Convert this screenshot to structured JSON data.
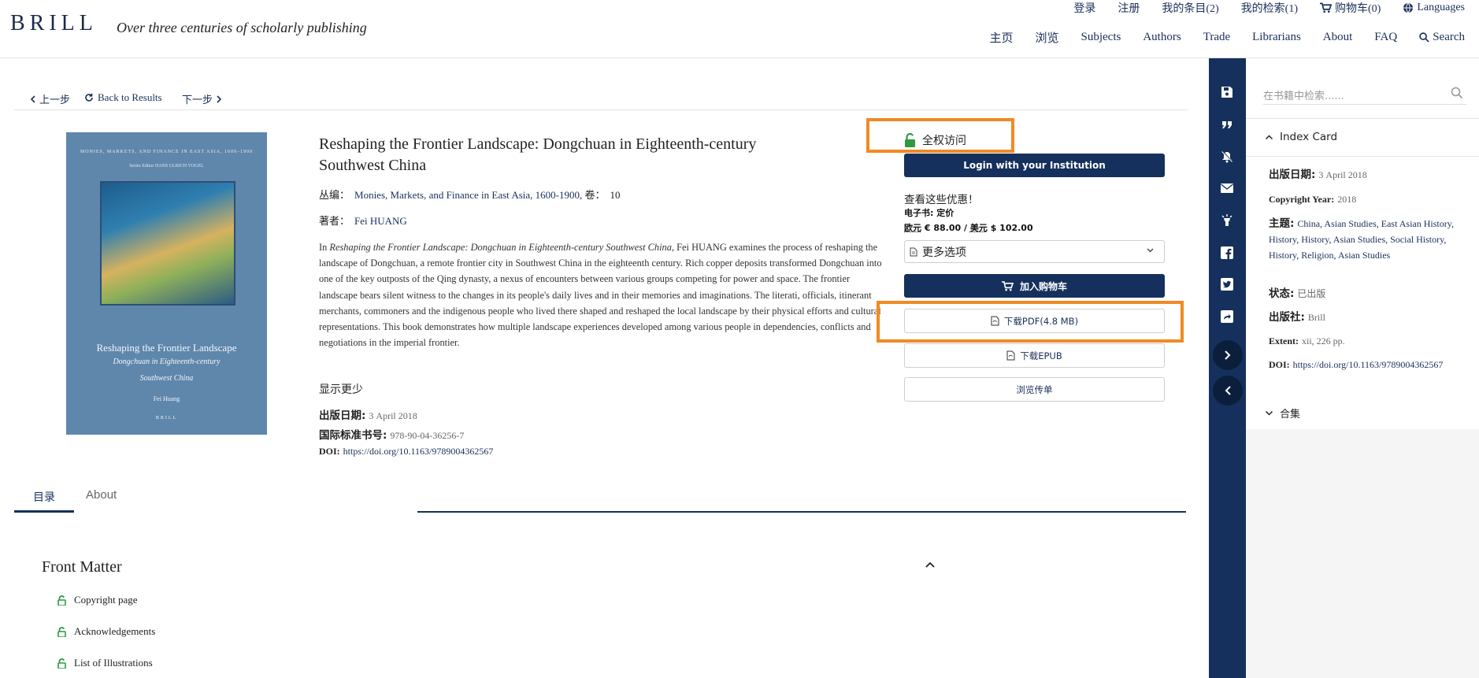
{
  "header": {
    "logo": "BRILL",
    "tagline": "Over three centuries of scholarly publishing",
    "utility_nav": [
      "登录",
      "注册",
      "我的条目(2)",
      "我的检索(1)",
      "购物车(0)",
      "Languages"
    ],
    "main_nav": [
      "主页",
      "浏览",
      "Subjects",
      "Authors",
      "Trade",
      "Librarians",
      "About",
      "FAQ",
      "Search"
    ]
  },
  "navigation": {
    "prev": "上一步",
    "back": "Back to Results",
    "next": "下一步"
  },
  "cover": {
    "series": "MONIES, MARKETS, AND FINANCE IN EAST ASIA, 1600–1900",
    "editor": "Series Editor HANS ULRICH VOGEL",
    "title": "Reshaping the Frontier Landscape",
    "subtitle_1": "Dongchuan in Eighteenth-century",
    "subtitle_2": "Southwest China",
    "author": "Fei Huang",
    "publisher": "BRILL"
  },
  "book": {
    "title": "Reshaping the Frontier Landscape: Dongchuan in Eighteenth-century Southwest China",
    "series_label": "丛编：",
    "series_value": "Monies, Markets, and Finance in East Asia, 1600-1900",
    "volume_label": "卷：",
    "volume_value": "10",
    "author_label": "著者：",
    "author_value": "Fei HUANG",
    "description_intro": "In ",
    "description_italic": "Reshaping the Frontier Landscape: Dongchuan in Eighteenth-century Southwest China",
    "description_rest": ", Fei HUANG examines the process of reshaping the landscape of Dongchuan, a remote frontier city in Southwest China in the eighteenth century. Rich copper deposits transformed Dongchuan into one of the key outposts of the Qing dynasty, a nexus of encounters between various groups competing for power and space. The frontier landscape bears silent witness to the changes in its people's daily lives and in their memories and imaginations. The literati, officials, itinerant merchants, commoners and the indigenous people who lived there shaped and reshaped the local landscape by their physical efforts and cultural representations. This book demonstrates how multiple landscape experiences developed among various people in dependencies, conflicts and negotiations in the imperial frontier.",
    "show_less": "显示更少",
    "pub_date_label": "出版日期:",
    "pub_date_value": "3 April 2018",
    "isbn_label": "国际标准书号:",
    "isbn_value": "978-90-04-36256-7",
    "doi_label": "DOI:",
    "doi_value": "https://doi.org/10.1163/9789004362567"
  },
  "purchase": {
    "open_access": "全权访问",
    "login_button": "Login with your Institution",
    "offers_heading": "查看这些优惠！",
    "ebook_label": "电子书: 定价",
    "price_eur_label": "欧元",
    "price_eur": "€ 88.00",
    "price_sep": "/",
    "price_usd_label": "美元",
    "price_usd": "$ 102.00",
    "more_options": "更多选项",
    "add_to_cart": "加入购物车",
    "download_pdf": "下载PDF(4.8 MB)",
    "download_epub": "下载EPUB",
    "browse_flyer": "浏览传单"
  },
  "tabs": [
    "目录",
    "About"
  ],
  "front_matter": {
    "heading": "Front Matter",
    "items": [
      "Copyright page",
      "Acknowledgements",
      "List of Illustrations"
    ]
  },
  "sidebar": {
    "search_placeholder": "在书籍中检索......",
    "index_card": "Index Card",
    "pub_date_label": "出版日期:",
    "pub_date_value": "3 April 2018",
    "copyright_label": "Copyright Year:",
    "copyright_value": "2018",
    "subjects_label": "主题:",
    "subjects": "China, Asian Studies, East Asian History, History, History, Asian Studies, Social History, History, Religion, Asian Studies",
    "status_label": "状态:",
    "status_value": "已出版",
    "publisher_label": "出版社:",
    "publisher_value": "Brill",
    "extent_label": "Extent:",
    "extent_value": "xii, 226 pp.",
    "doi_label": "DOI:",
    "doi_value": "https://doi.org/10.1163/9789004362567",
    "collections": "合集"
  },
  "colors": {
    "brand_navy": "#15305c",
    "highlight_orange": "#f08a24",
    "open_access_green": "#2e9a3e",
    "cover_blue": "#5f87ac"
  }
}
